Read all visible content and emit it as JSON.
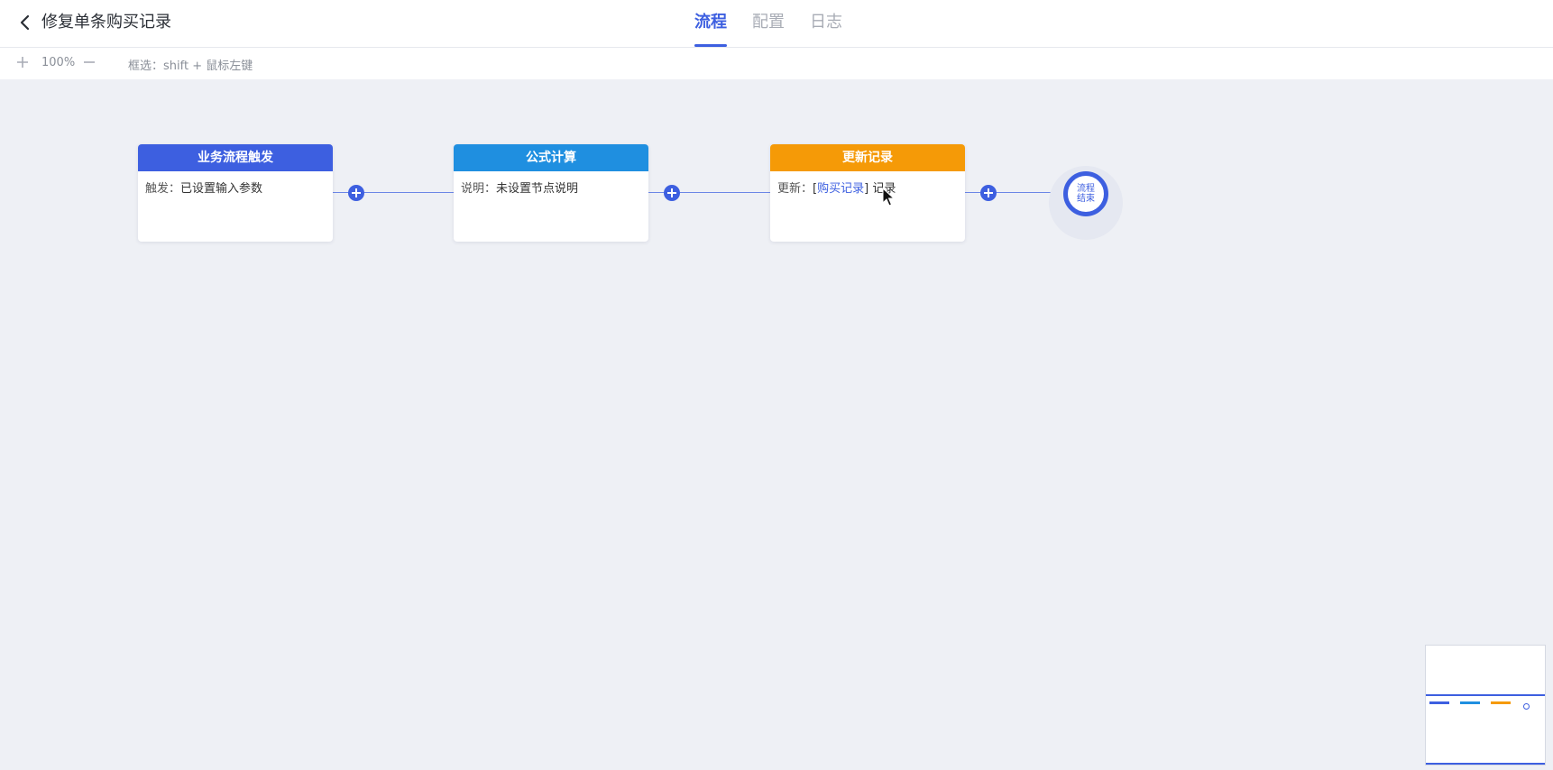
{
  "header": {
    "back_icon": "chevron-left-icon",
    "title": "修复单条购买记录",
    "tabs": [
      {
        "label": "流程",
        "active": true
      },
      {
        "label": "配置",
        "active": false
      },
      {
        "label": "日志",
        "active": false
      }
    ]
  },
  "toolbar": {
    "zoom_in_icon": "plus-icon",
    "zoom_level": "100%",
    "zoom_out_icon": "minus-icon",
    "select_hint": "框选：shift + 鼠标左键"
  },
  "flow": {
    "nodes": [
      {
        "title": "业务流程触发",
        "label": "触发：",
        "value": "已设置输入参数",
        "color": "#3d5fe0"
      },
      {
        "title": "公式计算",
        "label": "说明：",
        "value": "未设置节点说明",
        "color": "#1f8fe0"
      },
      {
        "title": "更新记录",
        "label": "更新：",
        "link": "购买记录",
        "value": "记录",
        "color": "#f59a07"
      }
    ],
    "add_icon": "plus-circle-icon",
    "end_label": "流程结束"
  },
  "colors": {
    "accent": "#3d5fe0",
    "canvas_bg": "#eef0f5"
  }
}
